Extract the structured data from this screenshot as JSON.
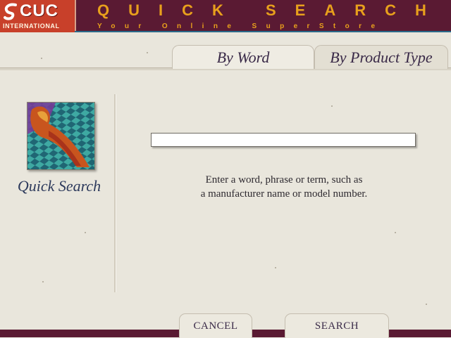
{
  "header": {
    "logo_text": "CUC",
    "logo_subtext": "INTERNATIONAL",
    "title": "QUICK SEARCH",
    "tagline": "Your Online SuperStore"
  },
  "tabs": [
    {
      "label": "By Word",
      "active": true
    },
    {
      "label": "By Product Type",
      "active": false
    }
  ],
  "left_panel": {
    "label": "Quick Search"
  },
  "search": {
    "value": "",
    "hint_line1": "Enter a word, phrase or term, such as",
    "hint_line2": "a manufacturer name or model number."
  },
  "footer": {
    "cancel_label": "CANCEL",
    "search_label": "SEARCH"
  },
  "colors": {
    "header_bg": "#5a1a33",
    "title_accent": "#e8a01c",
    "logo_bg": "#c8402a",
    "panel_bg": "#e9e6dc"
  }
}
